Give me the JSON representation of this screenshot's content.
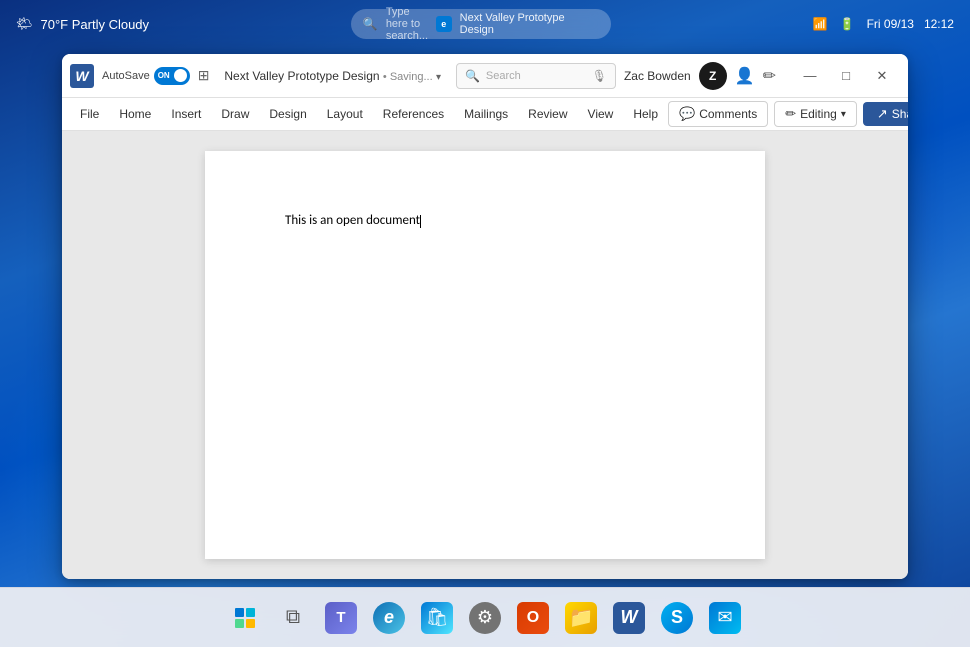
{
  "desktop": {
    "taskbar": {
      "icons": [
        {
          "name": "windows-start",
          "symbol": "⊞",
          "label": "Windows Start"
        },
        {
          "name": "task-view",
          "symbol": "❑❑",
          "label": "Task View"
        },
        {
          "name": "teams",
          "symbol": "T",
          "label": "Microsoft Teams"
        },
        {
          "name": "edge",
          "symbol": "e",
          "label": "Microsoft Edge"
        },
        {
          "name": "store",
          "symbol": "🛍",
          "label": "Microsoft Store"
        },
        {
          "name": "settings",
          "symbol": "⚙",
          "label": "Settings"
        },
        {
          "name": "office",
          "symbol": "O",
          "label": "Microsoft Office"
        },
        {
          "name": "file-explorer",
          "symbol": "📁",
          "label": "File Explorer"
        },
        {
          "name": "word",
          "symbol": "W",
          "label": "Microsoft Word"
        },
        {
          "name": "skype",
          "symbol": "S",
          "label": "Skype"
        },
        {
          "name": "mail",
          "symbol": "✉",
          "label": "Mail"
        }
      ]
    },
    "system_tray": {
      "weather": "70°F Partly Cloudy",
      "search_placeholder": "Type here to search...",
      "search_app_label": "Next Valley Prototype Design",
      "wifi_icon": "wifi",
      "battery_icon": "battery",
      "date": "Fri 09/13",
      "time": "12:12"
    }
  },
  "word": {
    "title_bar": {
      "app_icon": "W",
      "autosave_label": "AutoSave",
      "toggle_state": "ON",
      "doc_name": "Next Valley Prototype Design",
      "saving_status": "Saving...",
      "search_placeholder": "Search",
      "user_name": "Zac Bowden",
      "user_initial": "Z"
    },
    "window_controls": {
      "minimize": "—",
      "maximize": "□",
      "close": "✕"
    },
    "ribbon": {
      "menu_items": [
        "File",
        "Home",
        "Insert",
        "Draw",
        "Design",
        "Layout",
        "References",
        "Mailings",
        "Review",
        "View",
        "Help"
      ],
      "right_actions": {
        "comments_label": "Comments",
        "editing_label": "Editing",
        "share_label": "Share"
      }
    },
    "document": {
      "content": "This is an open document"
    }
  }
}
